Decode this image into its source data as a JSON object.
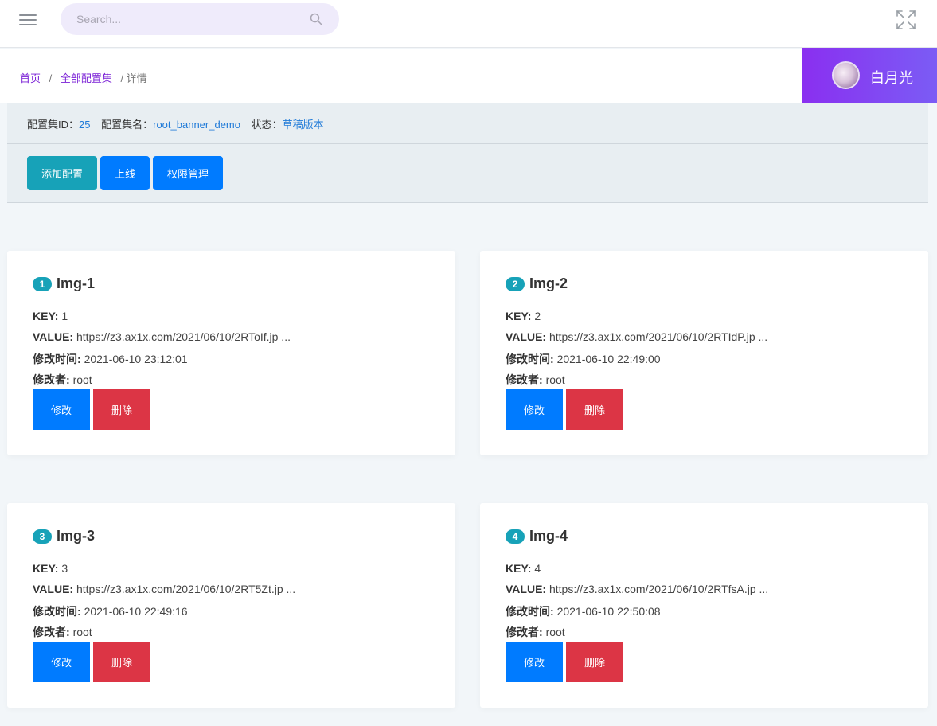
{
  "search": {
    "placeholder": "Search..."
  },
  "breadcrumb": {
    "home": "首页",
    "sep1": "/",
    "all_sets": "全部配置集",
    "current": "/ 详情"
  },
  "user": {
    "name": "白月光"
  },
  "info": {
    "id_label": "配置集ID：",
    "id_value": "25",
    "name_label": "配置集名：",
    "name_value": "root_banner_demo",
    "status_label": "状态：",
    "status_value": "草稿版本"
  },
  "actions": {
    "add": "添加配置",
    "online": "上线",
    "permissions": "权限管理"
  },
  "cards": [
    {
      "index": "1",
      "title": "Img-1",
      "key_label": "KEY:",
      "key": "1",
      "value_label": "VALUE:",
      "value": "https://z3.ax1x.com/2021/06/10/2RToIf.jp ...",
      "time_label": "修改时间:",
      "time": "2021-06-10 23:12:01",
      "author_label": "修改者:",
      "author": "root",
      "edit": "修改",
      "delete": "删除"
    },
    {
      "index": "2",
      "title": "Img-2",
      "key_label": "KEY:",
      "key": "2",
      "value_label": "VALUE:",
      "value": "https://z3.ax1x.com/2021/06/10/2RTIdP.jp ...",
      "time_label": "修改时间:",
      "time": "2021-06-10 22:49:00",
      "author_label": "修改者:",
      "author": "root",
      "edit": "修改",
      "delete": "删除"
    },
    {
      "index": "3",
      "title": "Img-3",
      "key_label": "KEY:",
      "key": "3",
      "value_label": "VALUE:",
      "value": "https://z3.ax1x.com/2021/06/10/2RT5Zt.jp ...",
      "time_label": "修改时间:",
      "time": "2021-06-10 22:49:16",
      "author_label": "修改者:",
      "author": "root",
      "edit": "修改",
      "delete": "删除"
    },
    {
      "index": "4",
      "title": "Img-4",
      "key_label": "KEY:",
      "key": "4",
      "value_label": "VALUE:",
      "value": "https://z3.ax1x.com/2021/06/10/2RTfsA.jp ...",
      "time_label": "修改时间:",
      "time": "2021-06-10 22:50:08",
      "author_label": "修改者:",
      "author": "root",
      "edit": "修改",
      "delete": "删除"
    }
  ],
  "colors": {
    "accent_purple": "#8a2ff0",
    "primary": "#007bff",
    "info": "#17a2b8",
    "danger": "#dc3545",
    "link": "#1f7ad8"
  }
}
